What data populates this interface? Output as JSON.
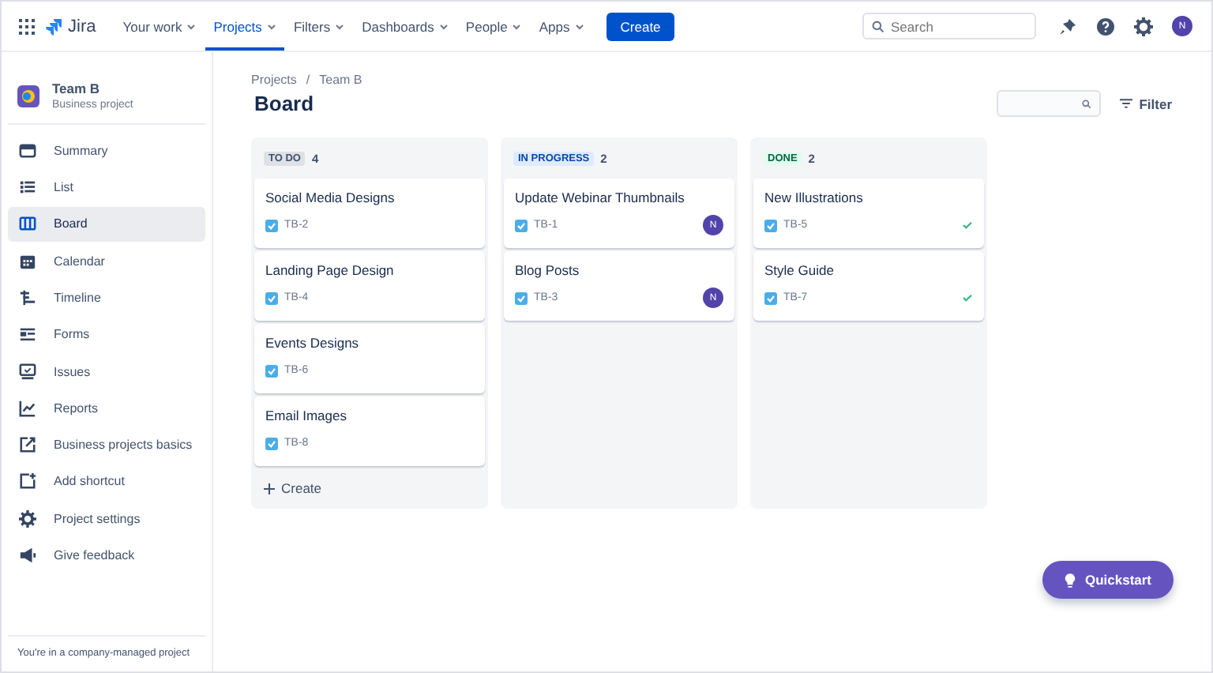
{
  "nav": {
    "logo": "Jira",
    "items": [
      {
        "label": "Your work",
        "selected": false
      },
      {
        "label": "Projects",
        "selected": true
      },
      {
        "label": "Filters",
        "selected": false
      },
      {
        "label": "Dashboards",
        "selected": false
      },
      {
        "label": "People",
        "selected": false
      },
      {
        "label": "Apps",
        "selected": false
      }
    ],
    "create": "Create",
    "search": {
      "placeholder": "Search"
    },
    "avatar": "N"
  },
  "sidebar": {
    "project": {
      "name": "Team B",
      "type": "Business project"
    },
    "items": [
      {
        "label": "Summary",
        "selected": false
      },
      {
        "label": "List",
        "selected": false
      },
      {
        "label": "Board",
        "selected": true
      },
      {
        "label": "Calendar",
        "selected": false
      },
      {
        "label": "Timeline",
        "selected": false
      },
      {
        "label": "Forms",
        "selected": false
      },
      {
        "label": "Issues",
        "selected": false
      },
      {
        "label": "Reports",
        "selected": false
      },
      {
        "label": "Business projects basics",
        "selected": false
      },
      {
        "label": "Add shortcut",
        "selected": false
      },
      {
        "label": "Project settings",
        "selected": false
      },
      {
        "label": "Give feedback",
        "selected": false
      }
    ],
    "footer": "You're in a company-managed project"
  },
  "breadcrumbs": [
    "Projects",
    "Team B"
  ],
  "breadcrumb_separator": "/",
  "title": "Board",
  "filter": "Filter",
  "columns": [
    {
      "name": "TO DO",
      "count": "4",
      "kind": "todo",
      "cards": [
        {
          "title": "Social Media Designs",
          "key": "TB-2",
          "resolved": false
        },
        {
          "title": "Landing Page Design",
          "key": "TB-4",
          "resolved": false
        },
        {
          "title": "Events Designs",
          "key": "TB-6",
          "resolved": false
        },
        {
          "title": "Email Images",
          "key": "TB-8",
          "resolved": false
        }
      ],
      "create": "Create"
    },
    {
      "name": "IN PROGRESS",
      "count": "2",
      "kind": "progress",
      "cards": [
        {
          "title": "Update Webinar Thumbnails",
          "key": "TB-1",
          "resolved": false,
          "assignee": "N"
        },
        {
          "title": "Blog Posts",
          "key": "TB-3",
          "resolved": false,
          "assignee": "N"
        }
      ]
    },
    {
      "name": "DONE",
      "count": "2",
      "kind": "done",
      "cards": [
        {
          "title": "New Illustrations",
          "key": "TB-5",
          "resolved": true
        },
        {
          "title": "Style Guide",
          "key": "TB-7",
          "resolved": true
        }
      ]
    }
  ],
  "quickstart": "Quickstart"
}
